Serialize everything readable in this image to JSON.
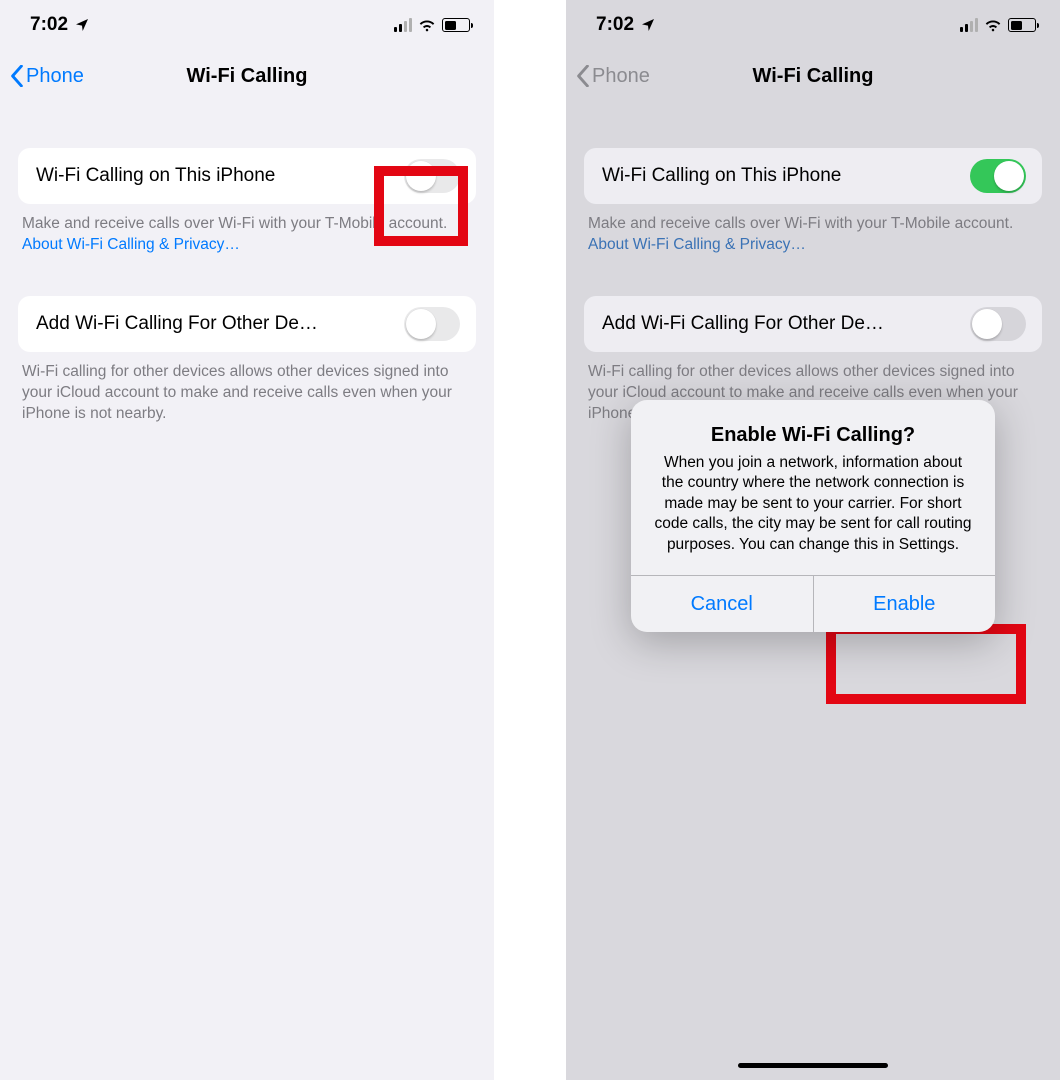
{
  "status": {
    "time": "7:02"
  },
  "nav": {
    "back_label": "Phone",
    "title": "Wi-Fi Calling"
  },
  "group1": {
    "label": "Wi-Fi Calling on This iPhone",
    "footer_text": "Make and receive calls over Wi-Fi with your T-Mobile account. ",
    "footer_link": "About Wi-Fi Calling & Privacy…"
  },
  "group2": {
    "label": "Add Wi-Fi Calling For Other De…",
    "footer_text_left": "Wi-Fi calling for other devices allows other devices signed into your iCloud account to make and receive calls even when your iPhone is not nearby."
  },
  "right_group2_footer_visible": "Wi-    ces sign   y. reco",
  "alert": {
    "title": "Enable Wi-Fi Calling?",
    "message": "When you join a network, information about the country where the network connection is made may be sent to your carrier. For short code calls, the city may be sent for call routing purposes. You can change this in Settings.",
    "cancel": "Cancel",
    "enable": "Enable"
  }
}
